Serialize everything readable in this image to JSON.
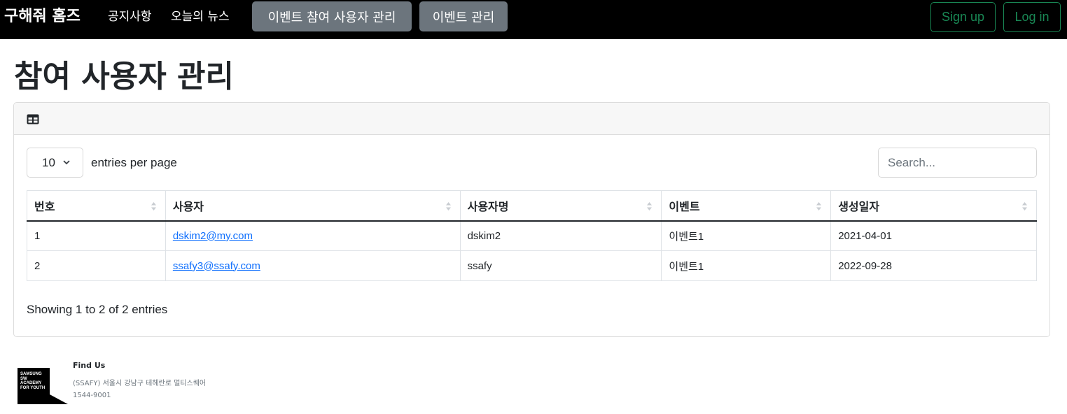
{
  "navbar": {
    "brand": "구해줘 홈즈",
    "links": [
      "공지사항",
      "오늘의 뉴스"
    ],
    "buttons": [
      "이벤트 참여 사용자 관리",
      "이벤트 관리"
    ],
    "sign_up": "Sign up",
    "log_in": "Log in"
  },
  "page": {
    "title": "참여 사용자 관리"
  },
  "card": {
    "header_icon": "table-icon",
    "per_page_value": "10",
    "per_page_label": "entries per page",
    "search_placeholder": "Search...",
    "columns": [
      "번호",
      "사용자",
      "사용자명",
      "이벤트",
      "생성일자"
    ],
    "rows": [
      {
        "no": "1",
        "user": "dskim2@my.com",
        "username": "dskim2",
        "event": "이벤트1",
        "created": "2021-04-01"
      },
      {
        "no": "2",
        "user": "ssafy3@ssafy.com",
        "username": "ssafy",
        "event": "이벤트1",
        "created": "2022-09-28"
      }
    ],
    "info": "Showing 1 to 2 of 2 entries"
  },
  "footer": {
    "logo_text": "SAMSUNG SW ACADEMY FOR YOUTH",
    "find_us": "Find Us",
    "address": "(SSAFY) 서울시 강남구 테헤란로 멀티스퀘어",
    "phone": "1544-9001"
  },
  "colors": {
    "navbar_bg": "#000000",
    "nav_button": "#6c757d",
    "outline_success": "#198754",
    "link": "#0d6efd"
  }
}
